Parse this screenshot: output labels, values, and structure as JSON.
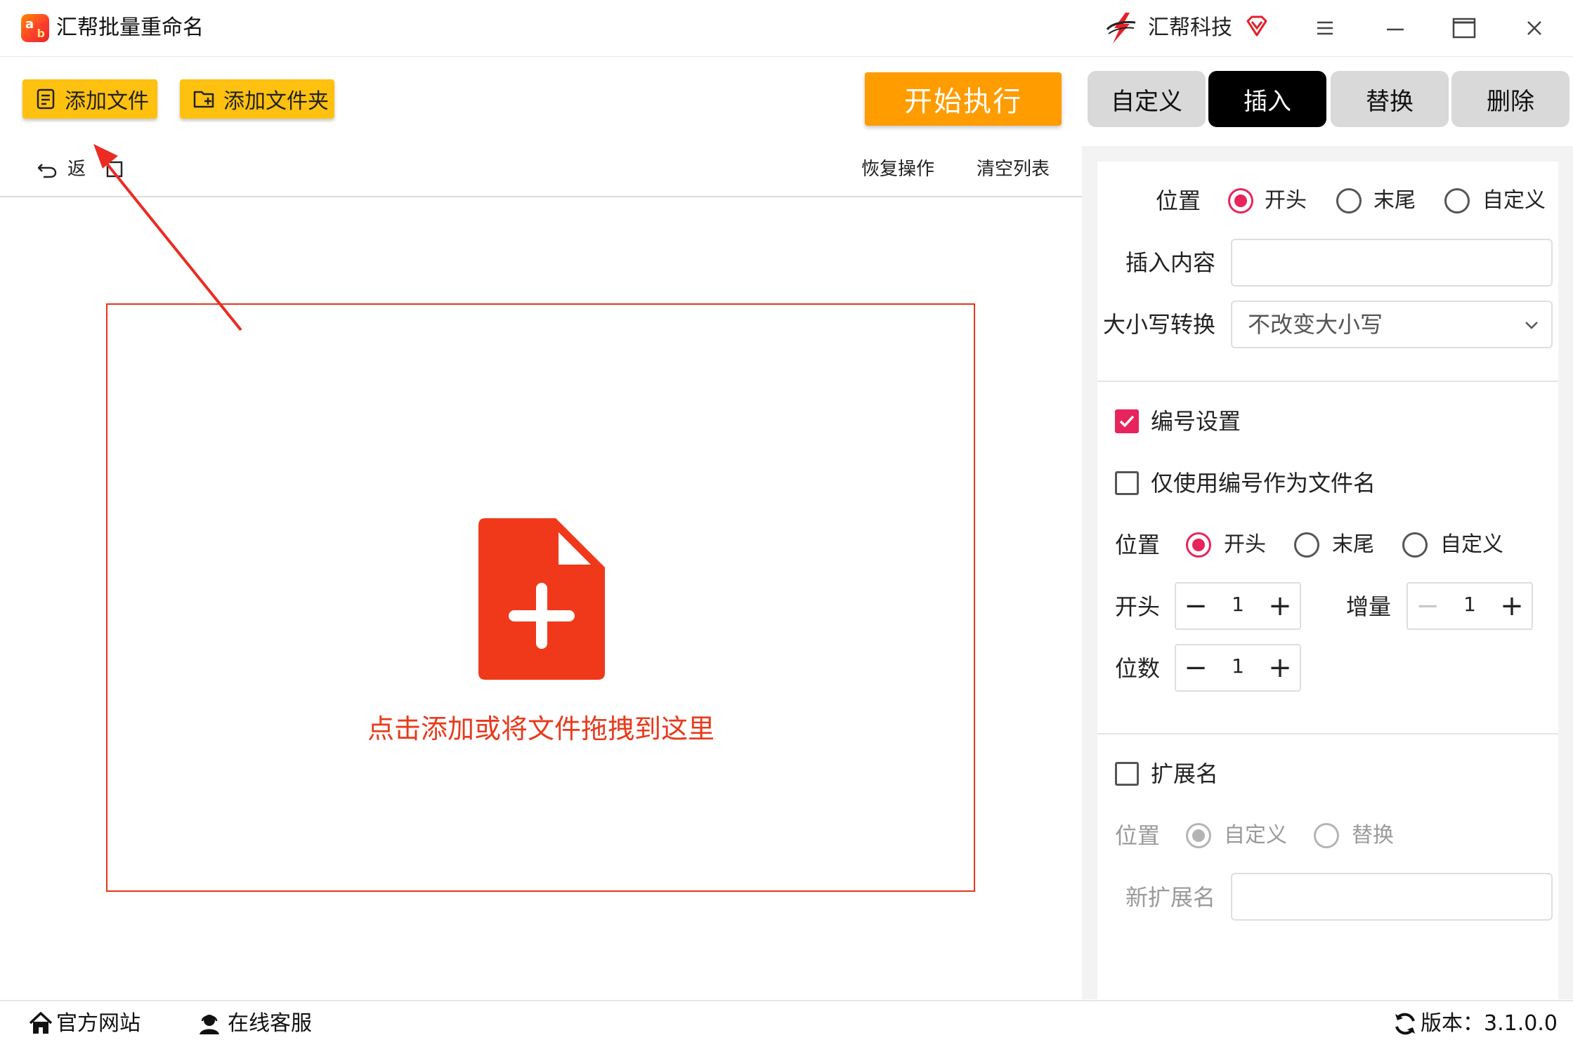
{
  "window": {
    "app_logo": {
      "letter_a": "a",
      "letter_b": "b"
    },
    "app_title": "汇帮批量重命名",
    "brand_name": "汇帮科技",
    "icons": [
      "brand-logo-icon",
      "vip-icon",
      "menu-icon",
      "minimize-icon",
      "maximize-icon",
      "close-icon"
    ]
  },
  "toolbar": {
    "add_file_label": "添加文件",
    "add_folder_label": "添加文件夹",
    "start_label": "开始执行",
    "tabs": [
      {
        "label": "自定义",
        "active": false
      },
      {
        "label": "插入",
        "active": true
      },
      {
        "label": "替换",
        "active": false
      },
      {
        "label": "删除",
        "active": false
      }
    ]
  },
  "list_actions": {
    "undo_label": "返",
    "restore_label": "恢复操作",
    "clear_label": "清空列表"
  },
  "drop_zone": {
    "hint": "点击添加或将文件拖拽到这里",
    "accent": "#e83a1c"
  },
  "insert_panel": {
    "position_label": "位置",
    "position_options": [
      "开头",
      "末尾",
      "自定义"
    ],
    "position_selected": "开头",
    "content_label": "插入内容",
    "content_value": "",
    "case_label": "大小写转换",
    "case_value": "不改变大小写"
  },
  "numbering": {
    "enable_label": "编号设置",
    "enabled": true,
    "only_number_label": "仅使用编号作为文件名",
    "only_number": false,
    "position_label": "位置",
    "position_options": [
      "开头",
      "末尾",
      "自定义"
    ],
    "position_selected": "开头",
    "start_label": "开头",
    "start_value": "1",
    "step_label": "增量",
    "step_value": "1",
    "digits_label": "位数",
    "digits_value": "1",
    "minus": "−",
    "plus": "+"
  },
  "extension": {
    "enable_label": "扩展名",
    "enabled": false,
    "position_label": "位置",
    "position_options": [
      "自定义",
      "替换"
    ],
    "position_selected": "自定义",
    "new_ext_label": "新扩展名",
    "new_ext_value": ""
  },
  "statusbar": {
    "website_label": "官方网站",
    "support_label": "在线客服",
    "version_label": "版本：3.1.0.0"
  },
  "colors": {
    "accent_pink": "#e8245d",
    "button_yellow": "#ffc10f",
    "start_orange": "#ff9c00",
    "active_tab": "#000000"
  }
}
